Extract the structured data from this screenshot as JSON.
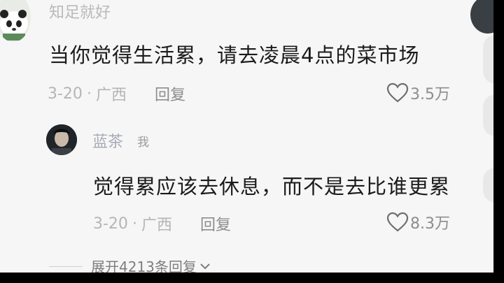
{
  "comments": [
    {
      "username": "知足就好",
      "text": "当你觉得生活累，请去凌晨4点的菜市场",
      "date": "3-20",
      "separator": "·",
      "location": "广西",
      "reply_label": "回复",
      "likes": "3.5万",
      "avatar_icon": "panda-avatar"
    },
    {
      "username": "蓝茶",
      "badge": "我",
      "text": "觉得累应该去休息，而不是去比谁更累",
      "date": "3-20",
      "separator": "·",
      "location": "广西",
      "reply_label": "回复",
      "likes": "8.3万",
      "avatar_icon": "user-avatar"
    }
  ],
  "expand_replies": "展开4213条回复",
  "icons": {
    "like": "heart-icon",
    "expand": "chevron-down-icon"
  },
  "colors": {
    "background": "#f6f6f6",
    "text": "#1b1b1b",
    "meta": "#b5b5b5",
    "username2": "#a8aab8"
  }
}
